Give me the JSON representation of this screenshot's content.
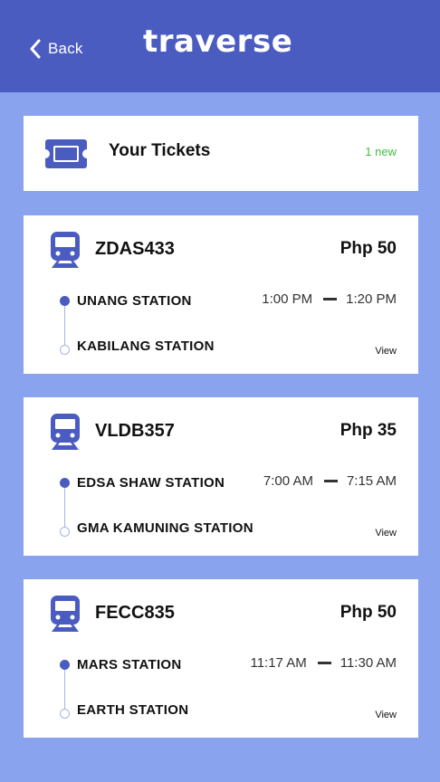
{
  "header": {
    "back_label": "Back",
    "logo": "traverse",
    "background": "#4b5cc1"
  },
  "tickets": {
    "title": "Your Tickets",
    "new_label": "1 new",
    "icon": "ticket-icon"
  },
  "trips": [
    {
      "code": "ZDAS433",
      "price": "Php 50",
      "from": "UNANG STATION",
      "to": "KABILANG STATION",
      "depart": "1:00 PM",
      "arrive": "1:20 PM",
      "view_label": "View",
      "icon": "train-icon"
    },
    {
      "code": "VLDB357",
      "price": "Php 35",
      "from": "EDSA SHAW STATION",
      "to": "GMA KAMUNING STATION",
      "depart": "7:00 AM",
      "arrive": "7:15 AM",
      "view_label": "View",
      "icon": "train-icon"
    },
    {
      "code": "FECC835",
      "price": "Php 50",
      "from": "MARS STATION",
      "to": "EARTH STATION",
      "depart": "11:17 AM",
      "arrive": "11:30 AM",
      "view_label": "View",
      "icon": "train-icon"
    }
  ],
  "colors": {
    "accent": "#4b5cc1",
    "page_background": "#8aa3ee",
    "new_badge": "#3fbf3f"
  }
}
